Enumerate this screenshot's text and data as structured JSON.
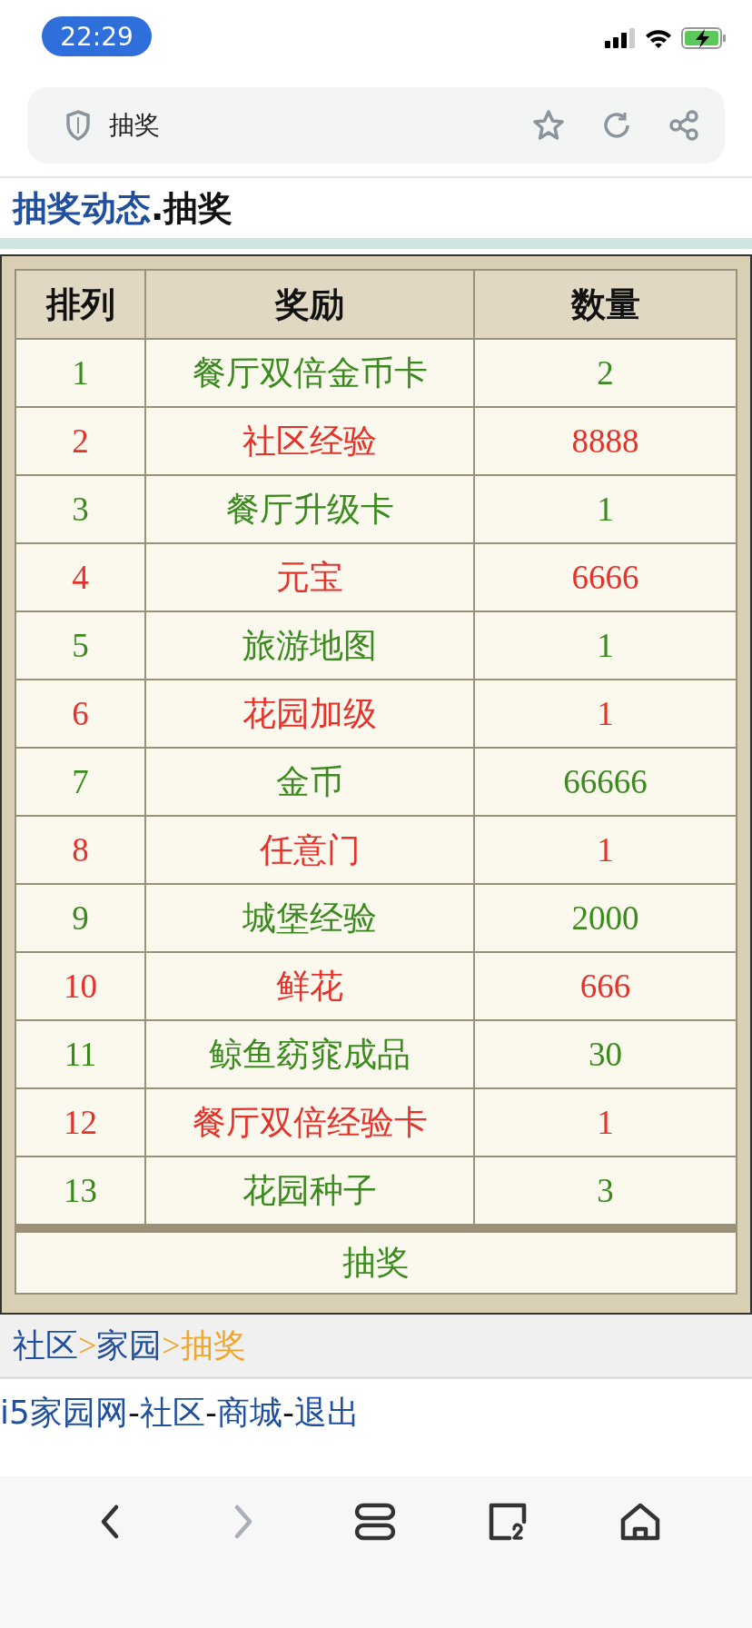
{
  "status_bar": {
    "time": "22:29"
  },
  "address_bar": {
    "title": "抽奖"
  },
  "heading": [
    {
      "text": "抽奖动态",
      "kind": "link"
    },
    {
      "text": ".",
      "kind": "plain"
    },
    {
      "text": "抽奖",
      "kind": "plain"
    }
  ],
  "table": {
    "columns": [
      "排列",
      "奖励",
      "数量"
    ],
    "rows": [
      {
        "rank": "1",
        "prize": "餐厅双倍金币卡",
        "amount": "2",
        "color": "#3b8a1e"
      },
      {
        "rank": "2",
        "prize": "社区经验",
        "amount": "8888",
        "color": "#e5322a"
      },
      {
        "rank": "3",
        "prize": "餐厅升级卡",
        "amount": "1",
        "color": "#3b8a1e"
      },
      {
        "rank": "4",
        "prize": "元宝",
        "amount": "6666",
        "color": "#e5322a"
      },
      {
        "rank": "5",
        "prize": "旅游地图",
        "amount": "1",
        "color": "#3b8a1e"
      },
      {
        "rank": "6",
        "prize": "花园加级",
        "amount": "1",
        "color": "#e5322a"
      },
      {
        "rank": "7",
        "prize": "金币",
        "amount": "66666",
        "color": "#3b8a1e"
      },
      {
        "rank": "8",
        "prize": "任意门",
        "amount": "1",
        "color": "#e5322a"
      },
      {
        "rank": "9",
        "prize": "城堡经验",
        "amount": "2000",
        "color": "#3b8a1e"
      },
      {
        "rank": "10",
        "prize": "鲜花",
        "amount": "666",
        "color": "#e5322a"
      },
      {
        "rank": "11",
        "prize": "鲸鱼窈窕成品",
        "amount": "30",
        "color": "#3b8a1e"
      },
      {
        "rank": "12",
        "prize": "餐厅双倍经验卡",
        "amount": "1",
        "color": "#e5322a"
      },
      {
        "rank": "13",
        "prize": "花园种子",
        "amount": "3",
        "color": "#3b8a1e"
      }
    ],
    "action": "抽奖"
  },
  "breadcrumb": [
    {
      "text": "社区",
      "kind": "link"
    },
    {
      "text": ">",
      "kind": "sep"
    },
    {
      "text": "家园",
      "kind": "link"
    },
    {
      "text": ">",
      "kind": "sep"
    },
    {
      "text": "抽奖",
      "kind": "current"
    }
  ],
  "footer_lines": [
    [
      {
        "text": "i5家园网",
        "kind": "link"
      },
      {
        "text": "-",
        "kind": "plain"
      },
      {
        "text": "社区",
        "kind": "link"
      },
      {
        "text": "-",
        "kind": "plain"
      },
      {
        "text": "商城",
        "kind": "link"
      },
      {
        "text": "-",
        "kind": "plain"
      },
      {
        "text": "退出",
        "kind": "link"
      }
    ]
  ]
}
